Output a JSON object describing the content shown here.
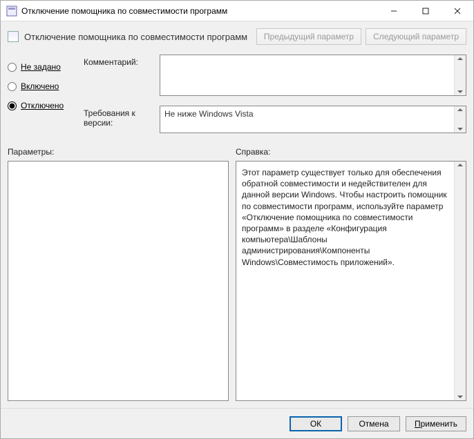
{
  "window": {
    "title": "Отключение помощника по совместимости программ"
  },
  "header": {
    "title": "Отключение помощника по совместимости программ",
    "prev_button": "Предыдущий параметр",
    "next_button": "Следующий параметр"
  },
  "options": {
    "not_configured": "Не задано",
    "enabled": "Включено",
    "disabled": "Отключено",
    "selected": "disabled"
  },
  "fields": {
    "comment_label": "Комментарий:",
    "comment_value": "",
    "requirements_label": "Требования к версии:",
    "requirements_value": "Не ниже Windows Vista"
  },
  "sections": {
    "params_label": "Параметры:",
    "help_label": "Справка:"
  },
  "help": {
    "text": "Этот параметр существует только для обеспечения обратной совместимости и недействителен для данной версии Windows. Чтобы настроить помощник по совместимости программ, используйте параметр «Отключение помощника по совместимости программ» в разделе «Конфигурация компьютера\\Шаблоны администрирования\\Компоненты Windows\\Совместимость приложений»."
  },
  "footer": {
    "ok": "ОК",
    "cancel": "Отмена",
    "apply": "Применить",
    "apply_hotkey": "П"
  }
}
